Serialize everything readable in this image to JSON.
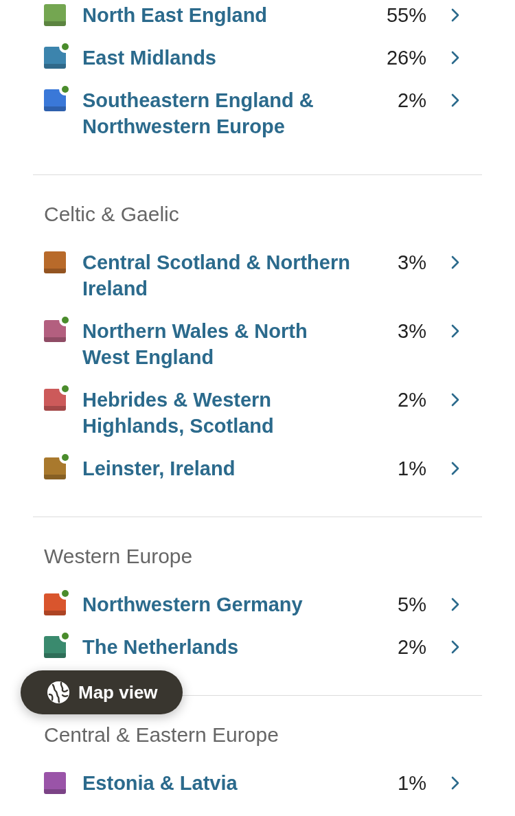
{
  "sections": [
    {
      "rows": [
        {
          "name": "North East England",
          "percent": "55%",
          "color": "#74a651",
          "updated": false
        },
        {
          "name": "East Midlands",
          "percent": "26%",
          "color": "#3c84ad",
          "updated": true
        },
        {
          "name": "Southeastern England & Northwestern Europe",
          "percent": "2%",
          "color": "#3a78d8",
          "updated": true
        }
      ]
    },
    {
      "heading": "Celtic & Gaelic",
      "rows": [
        {
          "name": "Central Scotland & Northern Ireland",
          "percent": "3%",
          "color": "#b86a2a",
          "updated": false
        },
        {
          "name": "Northern Wales & North West England",
          "percent": "3%",
          "color": "#b35f7f",
          "updated": true
        },
        {
          "name": "Hebrides & Western Highlands, Scotland",
          "percent": "2%",
          "color": "#cc5a5a",
          "updated": true
        },
        {
          "name": "Leinster, Ireland",
          "percent": "1%",
          "color": "#a9792d",
          "updated": true
        }
      ]
    },
    {
      "heading": "Western Europe",
      "rows": [
        {
          "name": "Northwestern Germany",
          "percent": "5%",
          "color": "#d9552d",
          "updated": true
        },
        {
          "name": "The Netherlands",
          "percent": "2%",
          "color": "#3a8a6e",
          "updated": true
        }
      ]
    },
    {
      "heading": "Central & Eastern Europe",
      "rows": [
        {
          "name": "Estonia & Latvia",
          "percent": "1%",
          "color": "#9a54a8",
          "updated": false
        }
      ]
    }
  ],
  "map_button": {
    "label": "Map view"
  }
}
